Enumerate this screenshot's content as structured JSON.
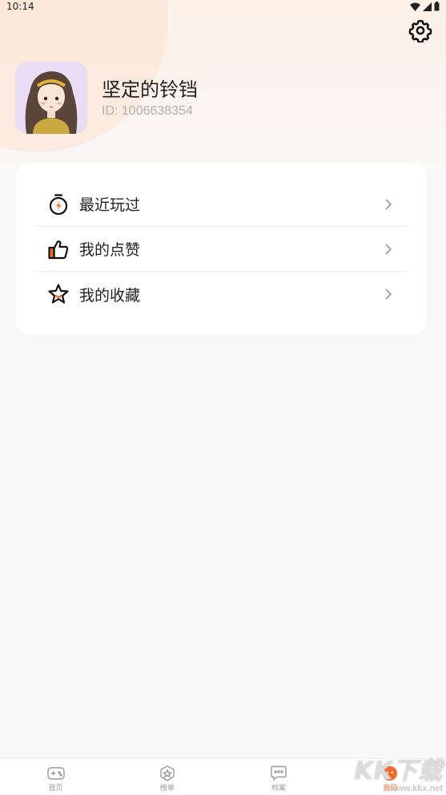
{
  "status_bar": {
    "time": "10:14"
  },
  "profile": {
    "name": "坚定的铃铛",
    "id_text": "ID: 1006638354"
  },
  "menu": {
    "items": [
      {
        "label": "最近玩过",
        "icon": "stopwatch-icon"
      },
      {
        "label": "我的点赞",
        "icon": "thumbs-up-icon"
      },
      {
        "label": "我的收藏",
        "icon": "star-icon"
      }
    ]
  },
  "tabbar": {
    "items": [
      {
        "label": "首页",
        "icon": "gamepad-icon",
        "active": false
      },
      {
        "label": "榜单",
        "icon": "ranking-icon",
        "active": false
      },
      {
        "label": "档案",
        "icon": "chat-icon",
        "active": false
      },
      {
        "label": "我的",
        "icon": "profile-icon",
        "active": true
      }
    ]
  },
  "watermark": {
    "big": "KK下载",
    "small": "www.kkx.net"
  },
  "colors": {
    "accent": "#f26b2a",
    "background": "#f8f8f8",
    "card": "#ffffff"
  }
}
